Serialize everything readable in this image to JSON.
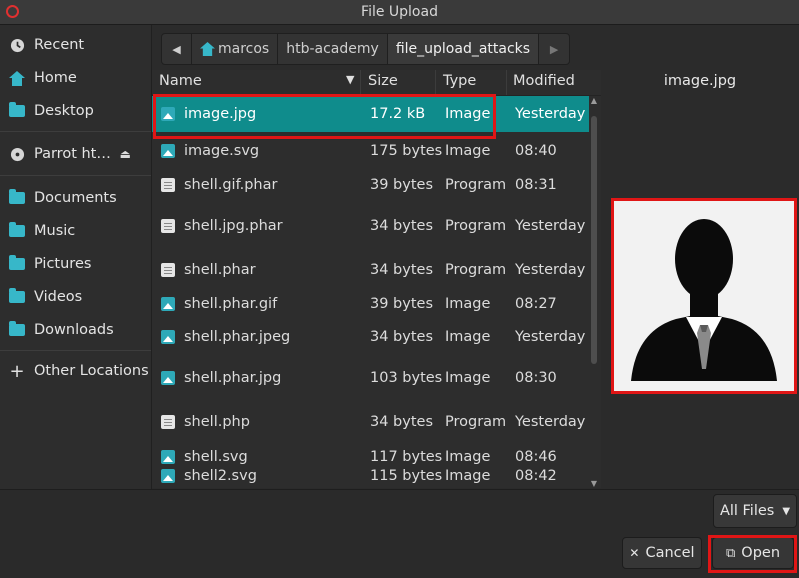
{
  "window": {
    "title": "File Upload"
  },
  "sidebar": {
    "items": [
      {
        "label": "Recent",
        "icon": "clock-icon"
      },
      {
        "label": "Home",
        "icon": "home-icon"
      },
      {
        "label": "Desktop",
        "icon": "folder-icon"
      },
      {
        "label": "Parrot ht…",
        "icon": "disc-icon"
      },
      {
        "label": "Documents",
        "icon": "folder-icon"
      },
      {
        "label": "Music",
        "icon": "folder-icon"
      },
      {
        "label": "Pictures",
        "icon": "folder-icon"
      },
      {
        "label": "Videos",
        "icon": "folder-icon"
      },
      {
        "label": "Downloads",
        "icon": "folder-icon"
      },
      {
        "label": "Other Locations",
        "icon": "plus-icon"
      }
    ]
  },
  "pathbar": {
    "crumbs": [
      "marcos",
      "htb-academy",
      "file_upload_attacks"
    ]
  },
  "list": {
    "columns": {
      "name": "Name",
      "size": "Size",
      "type": "Type",
      "modified": "Modified"
    },
    "rows": [
      {
        "name": "image.jpg",
        "size": "17.2 kB",
        "type": "Image",
        "modified": "Yesterday",
        "kind": "img",
        "selected": true
      },
      {
        "name": "image.svg",
        "size": "175 bytes",
        "type": "Image",
        "modified": "08:40",
        "kind": "img"
      },
      {
        "name": "shell.gif.phar",
        "size": "39 bytes",
        "type": "Program",
        "modified": "08:31",
        "kind": "doc"
      },
      {
        "name": "shell.jpg.phar",
        "size": "34 bytes",
        "type": "Program",
        "modified": "Yesterday",
        "kind": "doc"
      },
      {
        "name": "shell.phar",
        "size": "34 bytes",
        "type": "Program",
        "modified": "Yesterday",
        "kind": "doc"
      },
      {
        "name": "shell.phar.gif",
        "size": "39 bytes",
        "type": "Image",
        "modified": "08:27",
        "kind": "img"
      },
      {
        "name": "shell.phar.jpeg",
        "size": "34 bytes",
        "type": "Image",
        "modified": "Yesterday",
        "kind": "img"
      },
      {
        "name": "shell.phar.jpg",
        "size": "103 bytes",
        "type": "Image",
        "modified": "08:30",
        "kind": "img"
      },
      {
        "name": "shell.php",
        "size": "34 bytes",
        "type": "Program",
        "modified": "Yesterday",
        "kind": "doc"
      },
      {
        "name": "shell.svg",
        "size": "117 bytes",
        "type": "Image",
        "modified": "08:46",
        "kind": "img"
      },
      {
        "name": "shell2.svg",
        "size": "115 bytes",
        "type": "Image",
        "modified": "08:42",
        "kind": "img"
      }
    ]
  },
  "preview": {
    "filename": "image.jpg"
  },
  "footer": {
    "filter_label": "All Files",
    "cancel_label": "Cancel",
    "open_label": "Open"
  },
  "colors": {
    "selection": "#0f8c8c",
    "highlight_outline": "#e01616",
    "accent": "#37b7c9"
  }
}
